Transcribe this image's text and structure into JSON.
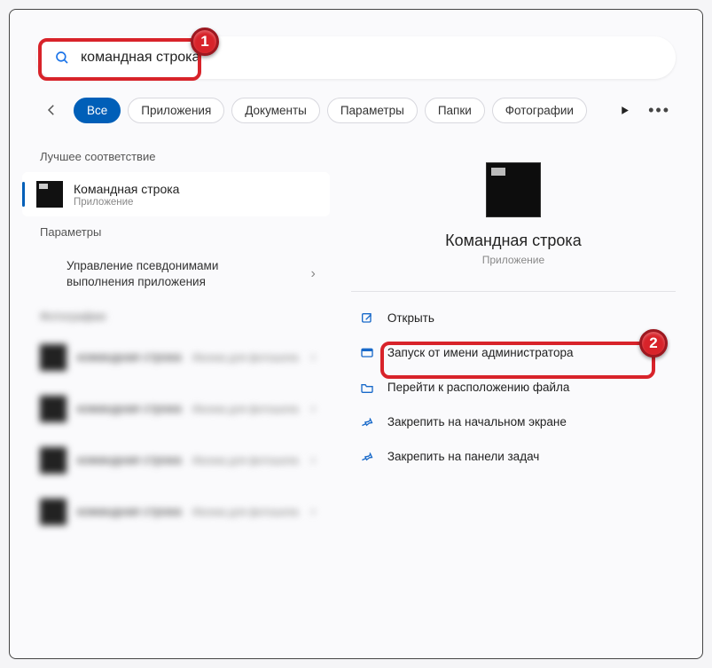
{
  "search": {
    "query": "командная строка"
  },
  "filters": {
    "all": "Все",
    "apps": "Приложения",
    "docs": "Документы",
    "params": "Параметры",
    "folders": "Папки",
    "photos": "Фотографии"
  },
  "sections": {
    "best_match": "Лучшее соответствие",
    "parameters": "Параметры",
    "photos": "Фотографии"
  },
  "best_match": {
    "title": "Командная строка",
    "subtitle": "Приложение"
  },
  "param_item": "Управление псевдонимами выполнения приложения",
  "blurred": {
    "row_title": "командная строка",
    "row_sub": "Иконка для фотошопа"
  },
  "preview": {
    "title": "Командная строка",
    "subtitle": "Приложение"
  },
  "actions": {
    "open": "Открыть",
    "run_admin": "Запуск от имени администратора",
    "open_location": "Перейти к расположению файла",
    "pin_start": "Закрепить на начальном экране",
    "pin_taskbar": "Закрепить на панели задач"
  },
  "annotations": {
    "step1": "1",
    "step2": "2"
  }
}
